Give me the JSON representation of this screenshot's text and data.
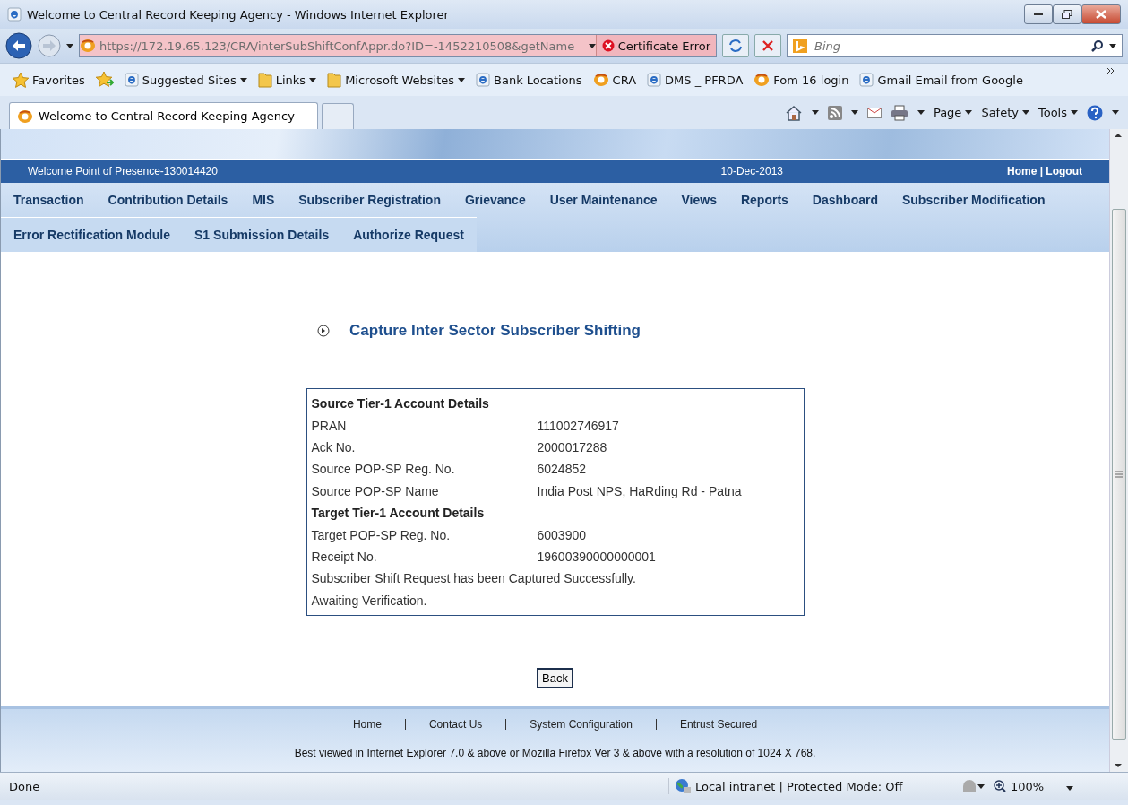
{
  "window": {
    "title": "Welcome to Central Record Keeping Agency - Windows Internet Explorer"
  },
  "address_bar": {
    "url": "https://172.19.65.123/CRA/interSubShiftConfAppr.do?ID=-1452210508&getName",
    "certificate": "Certificate Error",
    "search_placeholder": "Bing"
  },
  "favorites_bar": [
    {
      "label": "Favorites",
      "kind": "star",
      "menu": false
    },
    {
      "label": "Suggested Sites",
      "kind": "ie",
      "menu": true
    },
    {
      "label": "Links",
      "kind": "folder",
      "menu": true
    },
    {
      "label": "Microsoft Websites",
      "kind": "folder",
      "menu": true
    },
    {
      "label": "Bank Locations",
      "kind": "ie",
      "menu": false
    },
    {
      "label": "CRA",
      "kind": "site",
      "menu": false
    },
    {
      "label": "DMS _ PFRDA",
      "kind": "ie",
      "menu": false
    },
    {
      "label": "Fom 16 login",
      "kind": "site",
      "menu": false
    },
    {
      "label": "Gmail Email from Google",
      "kind": "ie",
      "menu": false
    }
  ],
  "tabs": [
    {
      "label": "Welcome to Central Record Keeping Agency",
      "selected": true
    }
  ],
  "command_bar": [
    "Page",
    "Safety",
    "Tools"
  ],
  "page": {
    "welcome": "Welcome Point of Presence-130014420",
    "date": "10-Dec-2013",
    "top_links": "Home | Logout",
    "menu_rows": [
      [
        "Transaction",
        "Contribution Details",
        "MIS",
        "Subscriber Registration",
        "Grievance",
        "User Maintenance",
        "Views",
        "Reports",
        "Dashboard",
        "Subscriber Modification"
      ],
      [
        "Error Rectification Module",
        "S1 Submission Details",
        "Authorize Request"
      ]
    ],
    "heading": "Capture Inter Sector Subscriber Shifting",
    "details": [
      {
        "kind": "section",
        "text": "Source Tier-1 Account Details"
      },
      {
        "kind": "field",
        "label": "PRAN",
        "value": "111002746917"
      },
      {
        "kind": "field",
        "label": "Ack No.",
        "value": "2000017288"
      },
      {
        "kind": "field",
        "label": "Source POP-SP Reg. No.",
        "value": "6024852"
      },
      {
        "kind": "field",
        "label": "Source POP-SP Name",
        "value": "India Post NPS, HaRding Rd - Patna"
      },
      {
        "kind": "section",
        "text": "Target Tier-1 Account Details"
      },
      {
        "kind": "field",
        "label": "Target POP-SP Reg. No.",
        "value": "6003900"
      },
      {
        "kind": "field",
        "label": "Receipt No.",
        "value": "19600390000000001"
      },
      {
        "kind": "message",
        "text": "Subscriber Shift Request has been Captured Successfully."
      },
      {
        "kind": "message",
        "text": "Awaiting Verification."
      }
    ],
    "back_button": "Back",
    "footer_links": [
      "Home",
      "Contact Us",
      "System Configuration",
      "Entrust Secured"
    ],
    "footer_note": "Best viewed in Internet Explorer 7.0 & above or Mozilla Firefox Ver 3 & above with a resolution of 1024 X 768."
  },
  "status_bar": {
    "status": "Done",
    "zone": "Local intranet | Protected Mode: Off",
    "zoom": "100%"
  }
}
